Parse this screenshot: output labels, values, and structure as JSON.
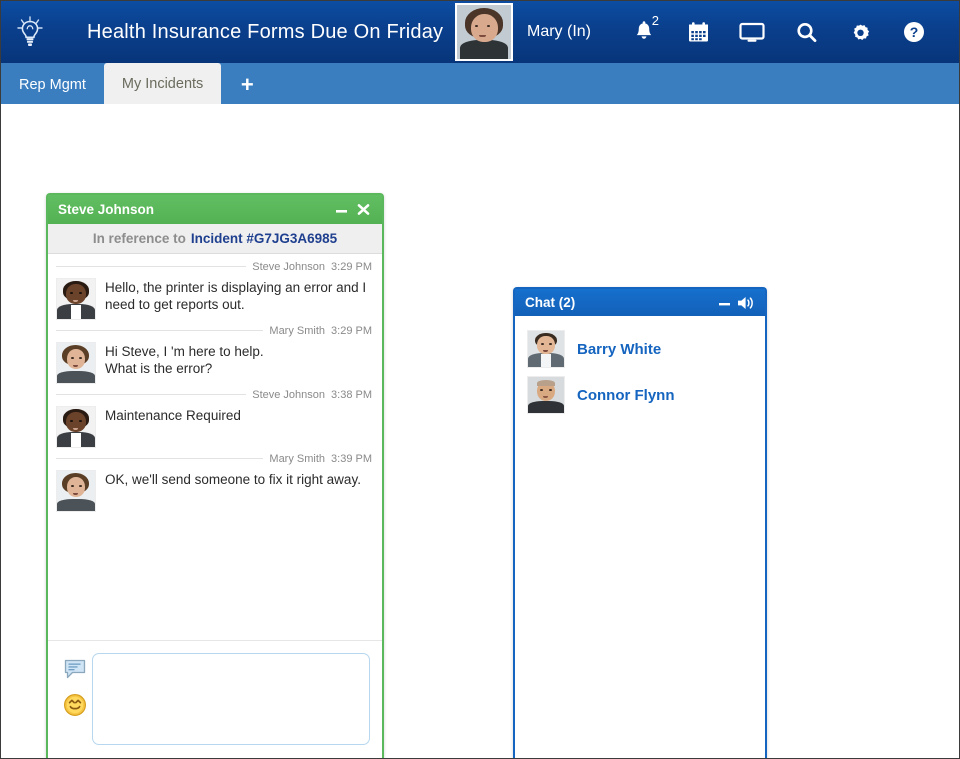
{
  "header": {
    "bulb_icon": "lightbulb-icon",
    "announcement": "Health Insurance Forms Due On Friday",
    "user_label": "Mary (In)",
    "avatar_name": "mary-smith-avatar",
    "icons": [
      {
        "name": "notifications-bell-icon",
        "badge": "2"
      },
      {
        "name": "calendar-icon",
        "badge": ""
      },
      {
        "name": "monitor-icon",
        "badge": ""
      },
      {
        "name": "search-icon",
        "badge": ""
      },
      {
        "name": "settings-gear-icon",
        "badge": ""
      },
      {
        "name": "help-icon",
        "badge": ""
      }
    ]
  },
  "tabs": {
    "items": [
      {
        "label": "Rep Mgmt",
        "active": false
      },
      {
        "label": "My Incidents",
        "active": true
      }
    ],
    "add_label": "+"
  },
  "interaction_window": {
    "title": "Steve Johnson",
    "minimize_label": "–",
    "close_label": "✖",
    "reference": {
      "prefix": "In reference to",
      "link": "Incident #G7JG3A6985"
    },
    "messages": [
      {
        "sender": "Steve Johnson",
        "time": "3:29 PM",
        "text": "Hello, the printer is displaying an error and I need to get reports out.",
        "avatar": "steve-johnson-avatar"
      },
      {
        "sender": "Mary Smith",
        "time": "3:29 PM",
        "text": "Hi Steve, I 'm here to help.\nWhat is the error?",
        "avatar": "mary-smith-avatar"
      },
      {
        "sender": "Steve Johnson",
        "time": "3:38 PM",
        "text": "Maintenance Required",
        "avatar": "steve-johnson-avatar"
      },
      {
        "sender": "Mary Smith",
        "time": "3:39 PM",
        "text": "OK, we'll send someone to fix it right away.",
        "avatar": "mary-smith-avatar"
      }
    ],
    "composer": {
      "value": "",
      "placeholder": "",
      "quick_response_icon": "chat-bubble-icon",
      "emoji_icon": "smiley-icon"
    }
  },
  "chat_panel": {
    "title": "Chat (2)",
    "minimize_label": "–",
    "sound_icon": "speaker-icon",
    "contacts": [
      {
        "name": "Barry White",
        "avatar": "barry-white-avatar"
      },
      {
        "name": "Connor Flynn",
        "avatar": "connor-flynn-avatar"
      }
    ]
  },
  "colors": {
    "header_blue": "#0a3f8c",
    "tab_blue": "#3a7ec0",
    "green_window": "#5cb85c",
    "panel_blue": "#1565c0",
    "link_blue": "#1f3f8f"
  }
}
